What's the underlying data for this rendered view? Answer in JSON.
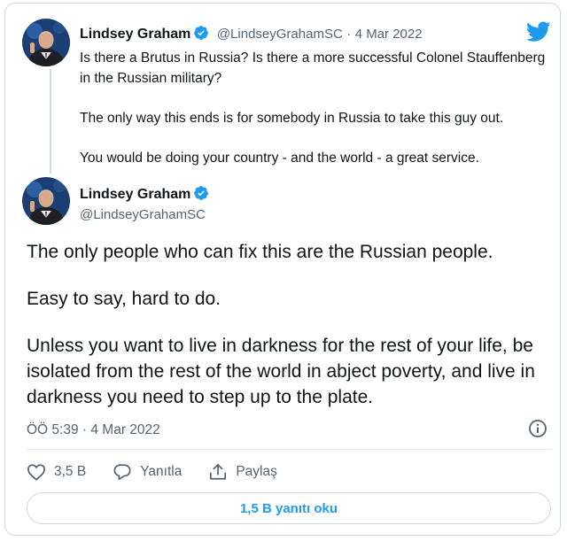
{
  "colors": {
    "accent": "#1d9bf0",
    "text": "#0f1419",
    "muted": "#536471",
    "border": "#cfd9de"
  },
  "tweet1": {
    "author_name": "Lindsey Graham",
    "handle": "@LindseyGrahamSC",
    "separator": "·",
    "date": "4 Mar 2022",
    "paragraphs": [
      "Is there a Brutus in Russia?  Is there a more successful Colonel Stauffenberg in the Russian military?",
      "The only way this ends is for somebody in Russia to take this guy out.",
      "You would be doing your country - and the world - a great service."
    ]
  },
  "tweet2": {
    "author_name": "Lindsey Graham",
    "handle": "@LindseyGrahamSC",
    "paragraphs": [
      "The only people who can fix this are the Russian people.",
      "Easy to say, hard to do.",
      "Unless you want to live in darkness for the rest of your life, be isolated from the rest of the world in abject poverty, and live in darkness you need to step up to the plate."
    ],
    "timestamp": "ÖÖ 5:39 · 4 Mar 2022",
    "likes": "3,5 B",
    "reply_label": "Yanıtla",
    "share_label": "Paylaş",
    "read_replies": "1,5 B yanıtı oku"
  },
  "icons": {
    "logo": "twitter-bird-icon",
    "verified": "verified-badge-icon",
    "info": "info-icon",
    "like": "heart-icon",
    "reply": "speech-bubble-icon",
    "share": "share-icon"
  }
}
